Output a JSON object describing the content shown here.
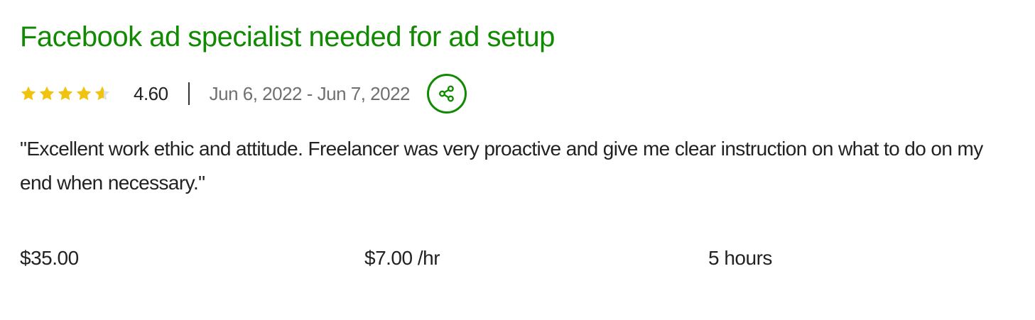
{
  "job": {
    "title": "Facebook ad specialist needed for ad setup",
    "rating": 4.6,
    "rating_label": "4.60",
    "rating_max": 5,
    "date_range": "Jun 6, 2022 - Jun 7, 2022",
    "feedback": "\"Excellent work ethic and attitude. Freelancer was very proactive and give me clear instruction on what to do on my end when necessary.\"",
    "earned": "$35.00",
    "rate": "$7.00 /hr",
    "hours": "5 hours"
  },
  "icons": {
    "star": "star-icon",
    "share": "share-icon"
  },
  "colors": {
    "title": "#108a00",
    "star_filled": "#f0c30f",
    "star_empty": "#e0e0e0",
    "share_accent": "#108a00",
    "muted_text": "#707070"
  }
}
